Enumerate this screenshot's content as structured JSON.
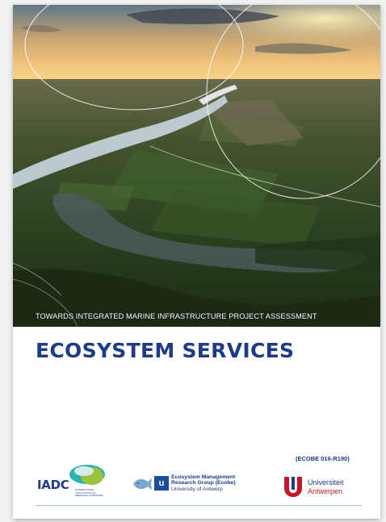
{
  "cover": {
    "subtitle": "TOWARDS INTEGRATED MARINE INFRASTRUCTURE PROJECT ASSESSMENT",
    "title": "ECOSYSTEM SERVICES",
    "report_code": "(ECOBE 016-R190)"
  },
  "logos": {
    "iadc": {
      "name": "IADC",
      "tagline": "INTERNATIONAL ASSOCIATION OF DREDGING COMPANIES"
    },
    "ecobe": {
      "line1": "Ecosystem Management",
      "line2": "Research Group (Ecobe)",
      "line3": "University of Antwerp"
    },
    "ua": {
      "line1": "Universiteit",
      "line2": "Antwerpen"
    }
  },
  "colors": {
    "title_blue": "#1f3a86",
    "ua_red": "#c2182b",
    "iadc_green": "#9bc23c",
    "iadc_cyan": "#2fb3b0"
  }
}
